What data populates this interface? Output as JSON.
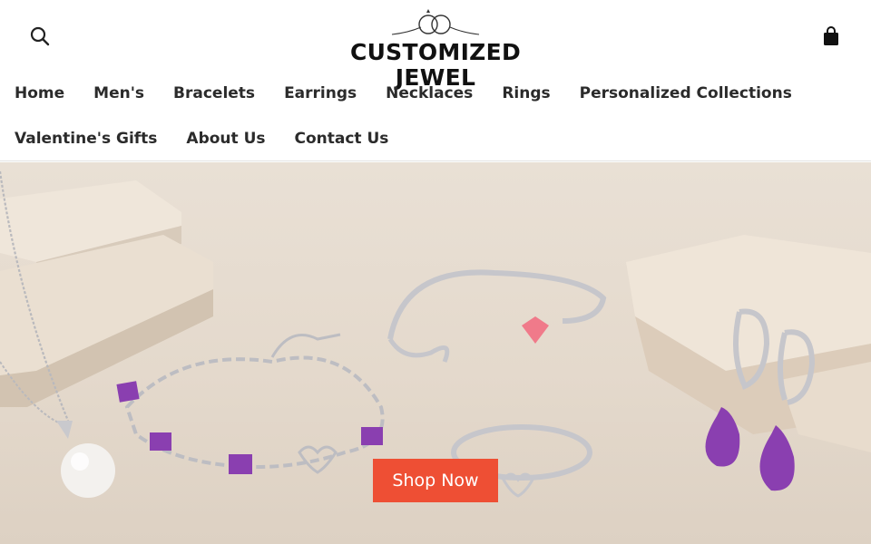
{
  "header": {
    "logo_text": "CUSTOMIZED JEWEL",
    "search_icon": "search-icon",
    "cart_icon": "shopping-bag-icon"
  },
  "nav": {
    "row1": [
      "Home",
      "Men's",
      "Bracelets",
      "Earrings",
      "Necklaces",
      "Rings",
      "Personalized Collections"
    ],
    "row2": [
      "Valentine's Gifts",
      "About Us",
      "Contact Us"
    ]
  },
  "hero": {
    "cta_label": "Shop Now",
    "cta_color": "#ee4f34",
    "gem_purple": "#8a3fb0",
    "gem_pink": "#f07a8a"
  }
}
